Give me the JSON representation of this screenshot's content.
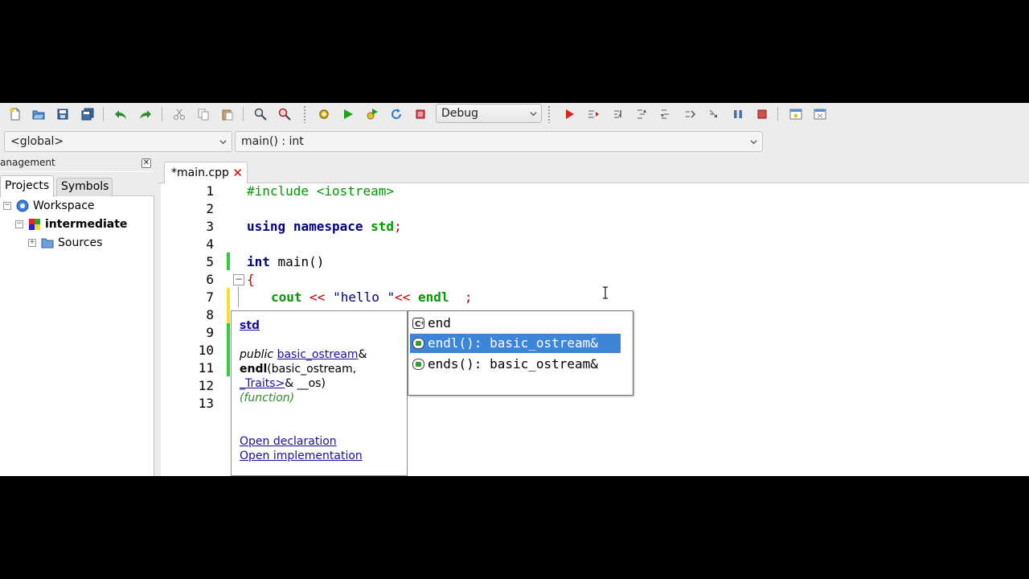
{
  "toolbar": {
    "build_config": "Debug",
    "icons": [
      "new-file-icon",
      "open-icon",
      "save-icon",
      "save-all-icon",
      "undo-icon",
      "redo-icon",
      "cut-icon",
      "copy-icon",
      "paste-icon",
      "find-icon",
      "replace-icon",
      "build-icon",
      "run-icon",
      "build-run-icon",
      "rebuild-icon",
      "abort-icon",
      "debug-icon",
      "run-to-cursor-icon",
      "next-line-icon",
      "step-into-icon",
      "step-out-icon",
      "next-instruction-icon",
      "step-instruction-icon",
      "break-icon",
      "stop-debugger-icon",
      "debug-windows-icon",
      "various-info-icon"
    ]
  },
  "scope": {
    "left": "<global>",
    "right": "main() : int"
  },
  "management": {
    "header": "anagement",
    "tabs": [
      "Projects",
      "Symbols"
    ],
    "tree": {
      "workspace": "Workspace",
      "project": "intermediate",
      "folder": "Sources"
    }
  },
  "editor": {
    "tab_label": "*main.cpp",
    "line_numbers": [
      "1",
      "2",
      "3",
      "4",
      "5",
      "6",
      "7",
      "8",
      "9",
      "10",
      "11",
      "12",
      "13"
    ],
    "lines": {
      "l1": "#include <iostream>",
      "l3_kw1": "using",
      "l3_kw2": "namespace",
      "l3_id": "std",
      "l3_semi": ";",
      "l5_kw": "int",
      "l5_rest": " main()",
      "l6": "{",
      "l7_cout": "cout",
      "l7_op1": " << ",
      "l7_str": "\"hello \"",
      "l7_op2": "<<",
      "l7_endl": " endl",
      "l7_semi": "  ;"
    }
  },
  "doc_popup": {
    "namespace": "std",
    "public": "public",
    "type_link": "basic_ostream",
    "amp": "&",
    "func_name": "endl",
    "params_a": "(basic_ostream,",
    "traits_link": "_Traits>",
    "params_b": "& __os)",
    "kind": "(function)",
    "open_decl": "Open declaration",
    "open_impl": "Open implementation"
  },
  "completion": {
    "items": [
      {
        "label": "end",
        "icon": "macro-icon"
      },
      {
        "label": "endl(): basic_ostream&",
        "icon": "function-icon",
        "selected": true
      },
      {
        "label": "ends(): basic_ostream&",
        "icon": "function-icon"
      }
    ]
  }
}
